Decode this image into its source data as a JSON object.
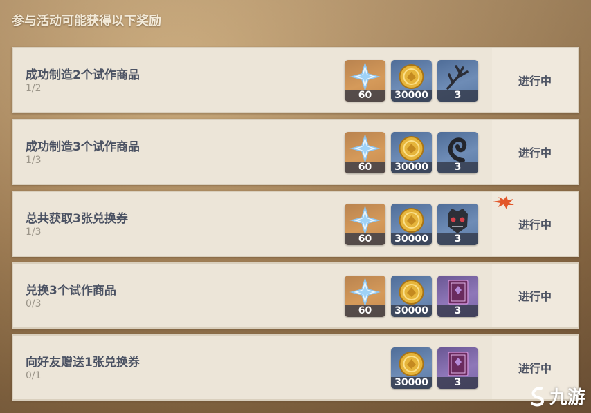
{
  "header": {
    "title": "参与活动可能获得以下奖励"
  },
  "rows": [
    {
      "title": "成功制造2个试作商品",
      "progress": "1/2",
      "status": "进行中",
      "rewards": [
        {
          "icon": "primogem-icon",
          "count": "60",
          "bg": "gold"
        },
        {
          "icon": "mora-icon",
          "count": "30000",
          "bg": "blue"
        },
        {
          "icon": "branch-material-icon",
          "count": "3",
          "bg": "blue"
        }
      ]
    },
    {
      "title": "成功制造3个试作商品",
      "progress": "1/3",
      "status": "进行中",
      "rewards": [
        {
          "icon": "primogem-icon",
          "count": "60",
          "bg": "gold"
        },
        {
          "icon": "mora-icon",
          "count": "30000",
          "bg": "blue"
        },
        {
          "icon": "horn-material-icon",
          "count": "3",
          "bg": "blue"
        }
      ]
    },
    {
      "title": "总共获取3张兑换券",
      "progress": "1/3",
      "status": "进行中",
      "rewards": [
        {
          "icon": "primogem-icon",
          "count": "60",
          "bg": "gold"
        },
        {
          "icon": "mora-icon",
          "count": "30000",
          "bg": "blue"
        },
        {
          "icon": "mask-material-icon",
          "count": "3",
          "bg": "blue"
        }
      ]
    },
    {
      "title": "兑换3个试作商品",
      "progress": "0/3",
      "status": "进行中",
      "rewards": [
        {
          "icon": "primogem-icon",
          "count": "60",
          "bg": "gold"
        },
        {
          "icon": "mora-icon",
          "count": "30000",
          "bg": "blue"
        },
        {
          "icon": "book-material-icon",
          "count": "3",
          "bg": "purple"
        }
      ]
    },
    {
      "title": "向好友赠送1张兑换券",
      "progress": "0/1",
      "status": "进行中",
      "rewards": [
        {
          "icon": "mora-icon",
          "count": "30000",
          "bg": "blue"
        },
        {
          "icon": "book-material-icon",
          "count": "3",
          "bg": "purple"
        }
      ]
    }
  ],
  "watermark": {
    "text": "九游"
  }
}
